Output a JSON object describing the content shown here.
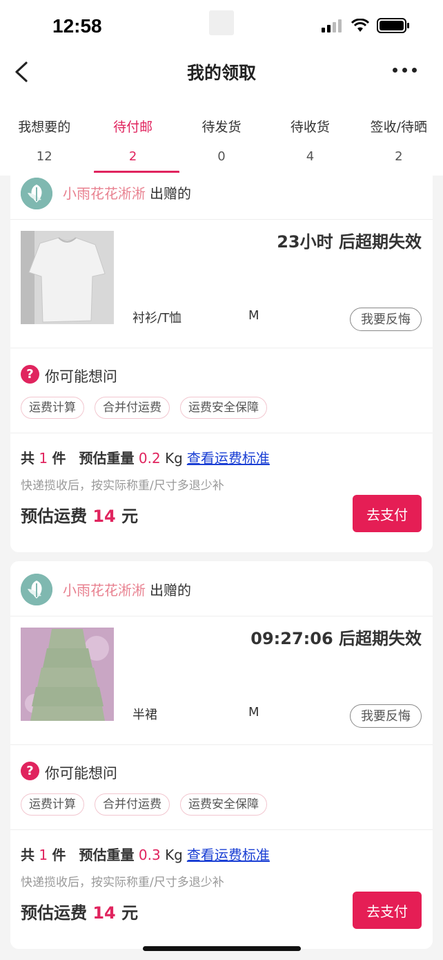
{
  "status": {
    "time": "12:58"
  },
  "nav": {
    "title": "我的领取"
  },
  "tabs": [
    {
      "label": "我想要的",
      "count": "12"
    },
    {
      "label": "待付邮",
      "count": "2"
    },
    {
      "label": "待发货",
      "count": "0"
    },
    {
      "label": "待收货",
      "count": "4"
    },
    {
      "label": "签收/待晒",
      "count": "2"
    }
  ],
  "active_tab": "待付邮",
  "colors": {
    "accent": "#e0245e",
    "link": "#1a3fd4",
    "giver_name": "#e8808f"
  },
  "cards": [
    {
      "giver_name": "小雨花花淅淅",
      "giver_suffix": "出赠的",
      "expire": "23小时 后超期失效",
      "category": "衬衫/T恤",
      "size": "M",
      "regret_label": "我要反悔",
      "faq_title": "你可能想问",
      "faq_tags": [
        "运费计算",
        "合并付运费",
        "运费安全保障"
      ],
      "count_prefix": "共",
      "count": "1",
      "count_unit": "件",
      "weight_label": "预估重量",
      "weight": "0.2",
      "weight_unit": "Kg",
      "fee_link": "查看运费标准",
      "note": "快递揽收后，按实际称重/尺寸多退少补",
      "fee_label": "预估运费",
      "fee": "14",
      "fee_unit": "元",
      "pay_label": "去支付"
    },
    {
      "giver_name": "小雨花花淅淅",
      "giver_suffix": "出赠的",
      "expire": "09:27:06 后超期失效",
      "category": "半裙",
      "size": "M",
      "regret_label": "我要反悔",
      "faq_title": "你可能想问",
      "faq_tags": [
        "运费计算",
        "合并付运费",
        "运费安全保障"
      ],
      "count_prefix": "共",
      "count": "1",
      "count_unit": "件",
      "weight_label": "预估重量",
      "weight": "0.3",
      "weight_unit": "Kg",
      "fee_link": "查看运费标准",
      "note": "快递揽收后，按实际称重/尺寸多退少补",
      "fee_label": "预估运费",
      "fee": "14",
      "fee_unit": "元",
      "pay_label": "去支付"
    }
  ]
}
